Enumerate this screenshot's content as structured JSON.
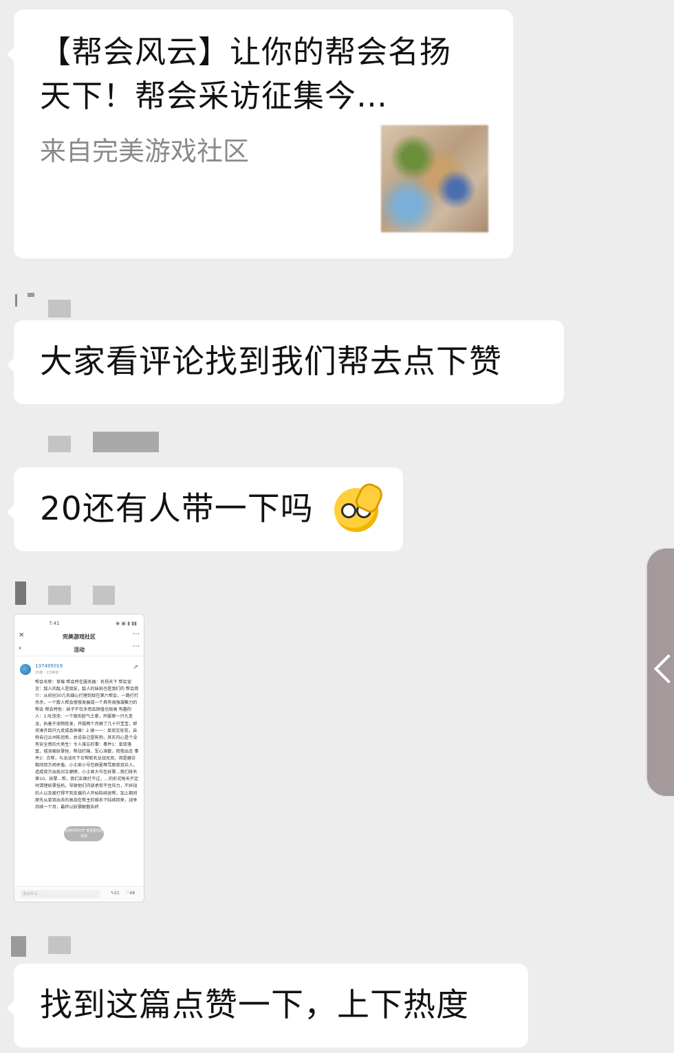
{
  "link_card": {
    "title": "【帮会风云】让你的帮会名扬天下！帮会采访征集今…",
    "source": "来自完美游戏社区"
  },
  "messages": [
    {
      "text": "大家看评论找到我们帮去点下赞"
    },
    {
      "text": "20还有人带一下吗",
      "emoji": "thinking-face-icon"
    },
    {
      "text": "找到这篇点赞一下，上下热度"
    }
  ],
  "screenshot": {
    "time": "7:41",
    "status_icons": "◉ ▣ ▮ ▮▮",
    "app_title": "完美游戏社区",
    "page_title": "活动",
    "user_id": "137495019",
    "floor": "25楼 · 1分钟前",
    "post_body": "帮会名称：草莓 帮会所在服务器：名扬天下 帮会宣言：敌人的敌人是朋友，敌人的妹纸也是我们的 帮会简介：从初创30几名细心打理到现在第六帮会，一路打打杀杀，一个散人帮会慢慢发展成一个具有很强凝聚力的帮会 帮会特色：妹子不仅多而且颜值也很高 有趣的人：1.吐泡泡：一个隐形欧气土豪，开服第一只九变龙，执着于宠物批发，开服两个月搞了几十只宝宝，即将凑齐四只九变成品神兽！2.德一一：单双交际花，自称自己兰州陈冠希，总说自己是陈狗，其实内心是个没有安全感的大男生！令人难忘的事：事件1：单双落寞，城池被妖孽抢，帮战打输，军心涣散，而我出走 事件2：合帮，与龙战天下合帮取名龙战无双，但是磨合期间双方闹矛盾，小土匪小号在群里辱骂原单双众人，造成双方出现对立摩擦，小土匪大号在妖孽…我们排名第10，妖孽…帮，我们正面打不过，…的形式每天不定时清理妖孽挂机，导致他们内部承受不住压力，不好战的人以及被打得不到支援的人开始陆续退帮，加上期间原先从单双出去的高战在帮主的维系下陆续回来，战争持续一个月，最终以妖孽解散告终",
    "overlay_text": "在APP内打开 享受更优质体验",
    "comment_placeholder": "说点什么...",
    "comment_count": "21",
    "like_count": "48"
  }
}
